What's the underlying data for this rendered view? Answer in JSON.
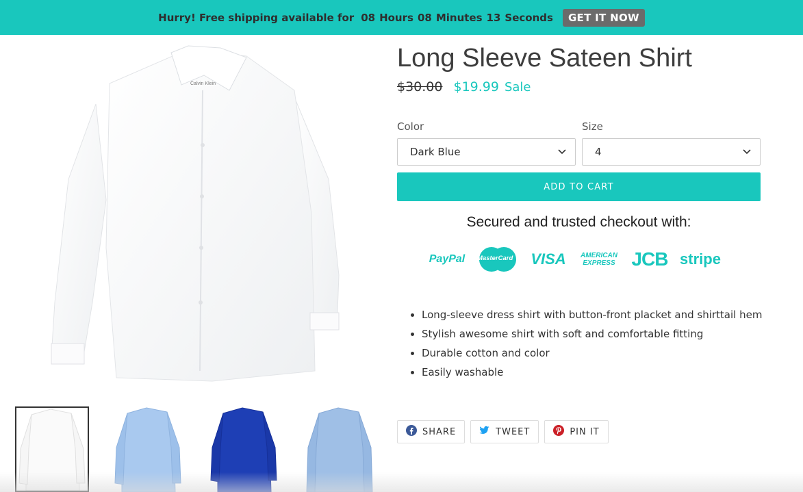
{
  "banner": {
    "text": "Hurry! Free shipping available for",
    "hours_num": "08",
    "hours_label": "Hours",
    "minutes_num": "08",
    "minutes_label": "Minutes",
    "seconds_num": "13",
    "seconds_label": "Seconds",
    "cta": "GET IT NOW"
  },
  "product": {
    "title": "Long Sleeve Sateen Shirt",
    "old_price": "$30.00",
    "new_price": "$19.99",
    "sale_label": "Sale"
  },
  "options": {
    "color_label": "Color",
    "color_value": "Dark Blue",
    "size_label": "Size",
    "size_value": "4"
  },
  "cart_button": "ADD TO CART",
  "checkout": {
    "heading": "Secured and trusted checkout with:",
    "paypal": "PayPal",
    "mastercard": "MasterCard",
    "visa": "VISA",
    "amex_line1": "AMERICAN",
    "amex_line2": "EXPRESS",
    "jcb": "JCB",
    "stripe": "stripe"
  },
  "features": [
    "Long-sleeve dress shirt with button-front placket and shirttail hem",
    "Stylish awesome shirt with soft and comfortable fitting",
    "Durable cotton and color",
    "Easily washable"
  ],
  "share": {
    "facebook": "SHARE",
    "twitter": "TWEET",
    "pinterest": "PIN IT"
  },
  "thumbnail_colors": [
    "#ffffff",
    "#a9c9ef",
    "#1e3fb5",
    "#9fbfe6"
  ],
  "accent_color": "#19c7bd"
}
